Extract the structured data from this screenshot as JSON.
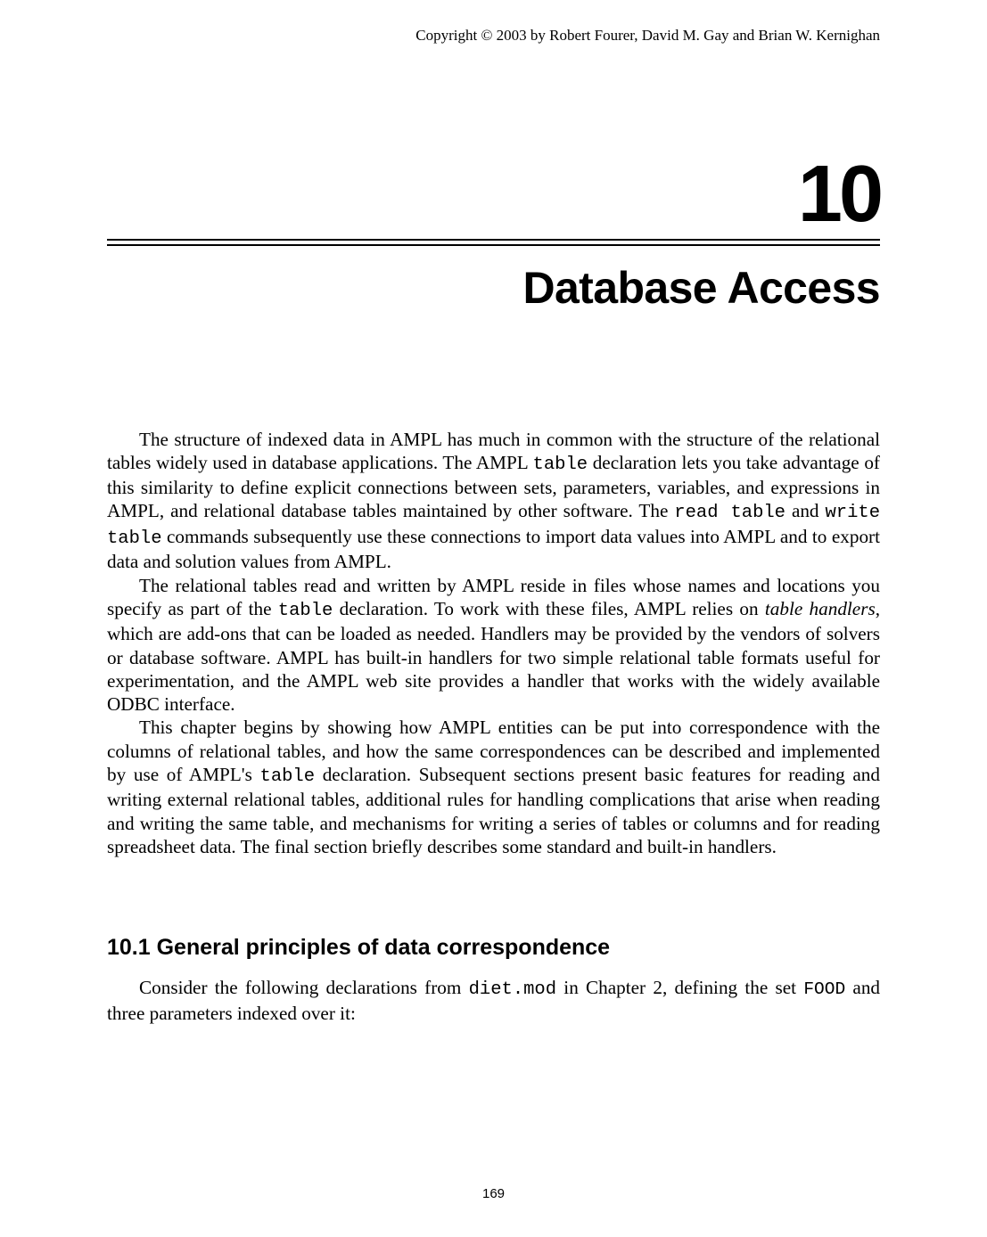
{
  "copyright": "Copyright © 2003 by Robert Fourer, David M. Gay and Brian W. Kernighan",
  "chapter": {
    "number": "10",
    "title": "Database Access"
  },
  "paragraphs": {
    "p1a": "The structure of indexed data in AMPL has much in common with the structure of the relational tables widely used in database applications. The AMPL ",
    "p1_code1": "table",
    "p1b": " declaration lets you take advantage of this similarity to define explicit connections between sets, parameters, variables, and expressions in AMPL, and relational database tables maintained by other software. The ",
    "p1_code2": "read table",
    "p1c": " and ",
    "p1_code3": "write table",
    "p1d": " commands subsequently use these connections to import data values into AMPL and to export data and solution values from AMPL.",
    "p2a": "The relational tables read and written by AMPL reside in files whose names and locations you specify as part of the ",
    "p2_code1": "table",
    "p2b": " declaration. To work with these files, AMPL relies on ",
    "p2_italic": "table handlers",
    "p2c": ", which are add-ons that can be loaded as needed. Handlers may be provided by the vendors of solvers or database software. AMPL has built-in handlers for two simple relational table formats useful for experimentation, and the AMPL web site provides a handler that works with the widely available ODBC interface.",
    "p3a": "This chapter begins by showing how AMPL entities can be put into correspondence with the columns of relational tables, and how the same correspondences can be described and implemented by use of AMPL's ",
    "p3_code1": "table",
    "p3b": " declaration. Subsequent sections present basic features for reading and writing external relational tables, additional rules for handling complications that arise when reading and writing the same table, and mechanisms for writing a series of tables or columns and for reading spreadsheet data. The final section briefly describes some standard and built-in handlers."
  },
  "section": {
    "heading": "10.1  General principles of data correspondence",
    "p1a": "Consider the following declarations from ",
    "p1_code1": "diet.mod",
    "p1b": " in Chapter 2, defining the set ",
    "p1_code2": "FOOD",
    "p1c": " and three parameters indexed over it:"
  },
  "page_number": "169"
}
